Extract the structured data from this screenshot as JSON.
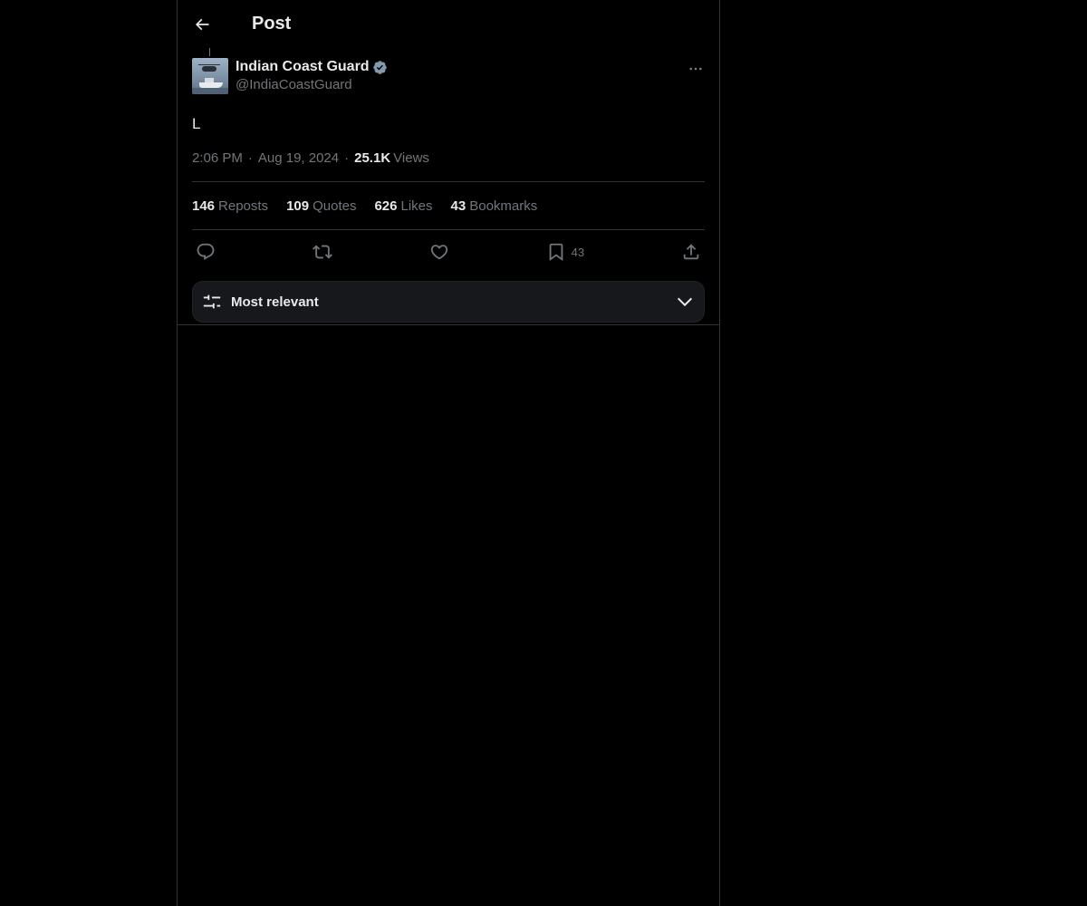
{
  "header": {
    "title": "Post",
    "back_icon": "arrow-left-icon"
  },
  "post": {
    "author": {
      "display_name": "Indian Coast Guard",
      "handle": "@IndiaCoastGuard",
      "verified": true,
      "verified_color": "#829aab"
    },
    "text": "L",
    "time": "2:06 PM",
    "date": "Aug 19, 2024",
    "views_count": "25.1K",
    "views_label": "Views"
  },
  "stats": [
    {
      "count": "146",
      "label": "Reposts"
    },
    {
      "count": "109",
      "label": "Quotes"
    },
    {
      "count": "626",
      "label": "Likes"
    },
    {
      "count": "43",
      "label": "Bookmarks"
    }
  ],
  "actions": {
    "reply_icon": "reply-icon",
    "repost_icon": "repost-icon",
    "like_icon": "heart-icon",
    "bookmark_icon": "bookmark-icon",
    "bookmark_count": "43",
    "share_icon": "share-icon"
  },
  "sort": {
    "label": "Most relevant",
    "icon": "sliders-icon",
    "chevron": "chevron-down-icon"
  },
  "colors": {
    "background": "#000000",
    "text": "#e7e9ea",
    "muted": "#71767b",
    "border": "#2f3336"
  }
}
